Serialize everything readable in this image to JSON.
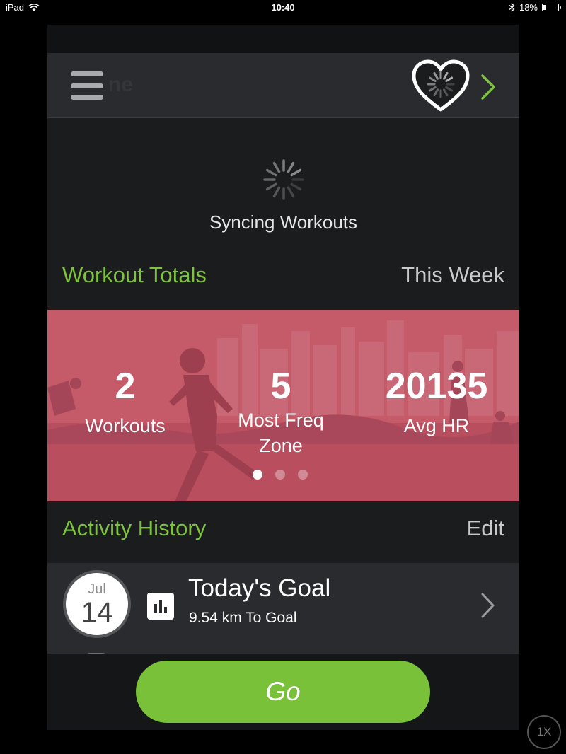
{
  "status_bar": {
    "device": "iPad",
    "time": "10:40",
    "battery": "18%",
    "battery_level": 0.18
  },
  "header": {
    "ghost_logo_text": "ne",
    "menu_icon": "hamburger-icon",
    "heart_icon": "heart-sync-icon",
    "next_icon": "chevron-right-icon"
  },
  "sync": {
    "text": "Syncing Workouts"
  },
  "totals_section": {
    "title": "Workout Totals",
    "period": "This Week"
  },
  "banner": {
    "stats": [
      {
        "value": "2",
        "label_line1": "Workouts",
        "label_line2": ""
      },
      {
        "value": "5",
        "label_line1": "Most Freq",
        "label_line2": "Zone"
      },
      {
        "value": "20135",
        "label_line1": "Avg HR",
        "label_line2": ""
      }
    ],
    "page_count": 3,
    "active_page": 0,
    "tint_color": "#c55a69"
  },
  "history_section": {
    "title": "Activity History",
    "action": "Edit"
  },
  "goal": {
    "month": "Jul",
    "day": "14",
    "title": "Today's Goal",
    "subtitle": "9.54 km To Goal"
  },
  "footer": {
    "go_label": "Go"
  },
  "zoom": {
    "label": "1X"
  },
  "colors": {
    "accent_green": "#7ec33d",
    "button_green": "#7ac13a",
    "background": "#1b1c1e"
  }
}
